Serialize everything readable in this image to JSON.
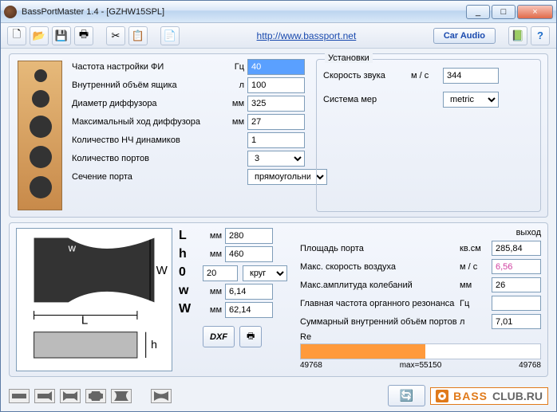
{
  "window": {
    "title": "BassPortMaster 1.4  - [GZHW15SPL]",
    "min": "_",
    "max": "□",
    "close": "×"
  },
  "toolbar": {
    "new": "🗋",
    "open": "📂",
    "save": "💾",
    "print": "🖶",
    "cut": "✂",
    "copy": "📋",
    "notes": "📄",
    "url": "http://www.bassport.net",
    "caraudio": "Car Audio",
    "help_book": "📗",
    "help_q": "?"
  },
  "params": {
    "labels": {
      "tune_freq": "Частота настройки ФИ",
      "box_volume": "Внутренний объём ящика",
      "cone_dia": "Диаметр диффузора",
      "xmax": "Максимальный ход диффузора",
      "num_woofers": "Количество НЧ динамиков",
      "num_ports": "Количество портов",
      "port_section": "Сечение порта"
    },
    "units": {
      "hz": "Гц",
      "l": "л",
      "mm": "мм"
    },
    "values": {
      "tune_freq": "40",
      "box_volume": "100",
      "cone_dia": "325",
      "xmax": "27",
      "num_woofers": "1",
      "num_ports": "3",
      "port_section": "прямоугольник"
    }
  },
  "settings": {
    "legend": "Установки",
    "sound_speed_label": "Скорость звука",
    "sound_speed_unit": "м / с",
    "sound_speed": "344",
    "system_label": "Система мер",
    "system": "metric"
  },
  "dims": {
    "L_sym": "L",
    "h_sym": "h",
    "zero_sym": "0",
    "w_sym": "w",
    "W_sym": "W",
    "unit": "мм",
    "L": "280",
    "h": "460",
    "stepper": "20",
    "shape": "круг",
    "w": "6,14",
    "W": "62,14"
  },
  "diagram": {
    "w_label": "w",
    "W_label": "W",
    "L_label": "L",
    "h_label": "h"
  },
  "buttons": {
    "dxf": "DXF",
    "print_icon": "🖶",
    "refresh": "🔄"
  },
  "output": {
    "header": "выход",
    "port_area_label": "Площадь порта",
    "port_area_unit": "кв.см",
    "port_area": "285,84",
    "air_vel_label": "Макс. скорость воздуха",
    "air_vel_unit": "м / с",
    "air_vel": "6,56",
    "amp_label": "Макс.амплитуда колебаний",
    "amp_unit": "мм",
    "amp": "26",
    "organ_label": "Главная частота органного резонанса",
    "organ_unit": "Гц",
    "organ": "",
    "total_vol_label": "Суммарный внутренний объём портов",
    "total_vol_unit": "л",
    "total_vol": "7,01",
    "re_label": "Re",
    "re_left": "49768",
    "re_mid": "max=55150",
    "re_right": "49768"
  },
  "bassclub": {
    "t1": "BASS",
    "t2": "CLUB.RU"
  }
}
